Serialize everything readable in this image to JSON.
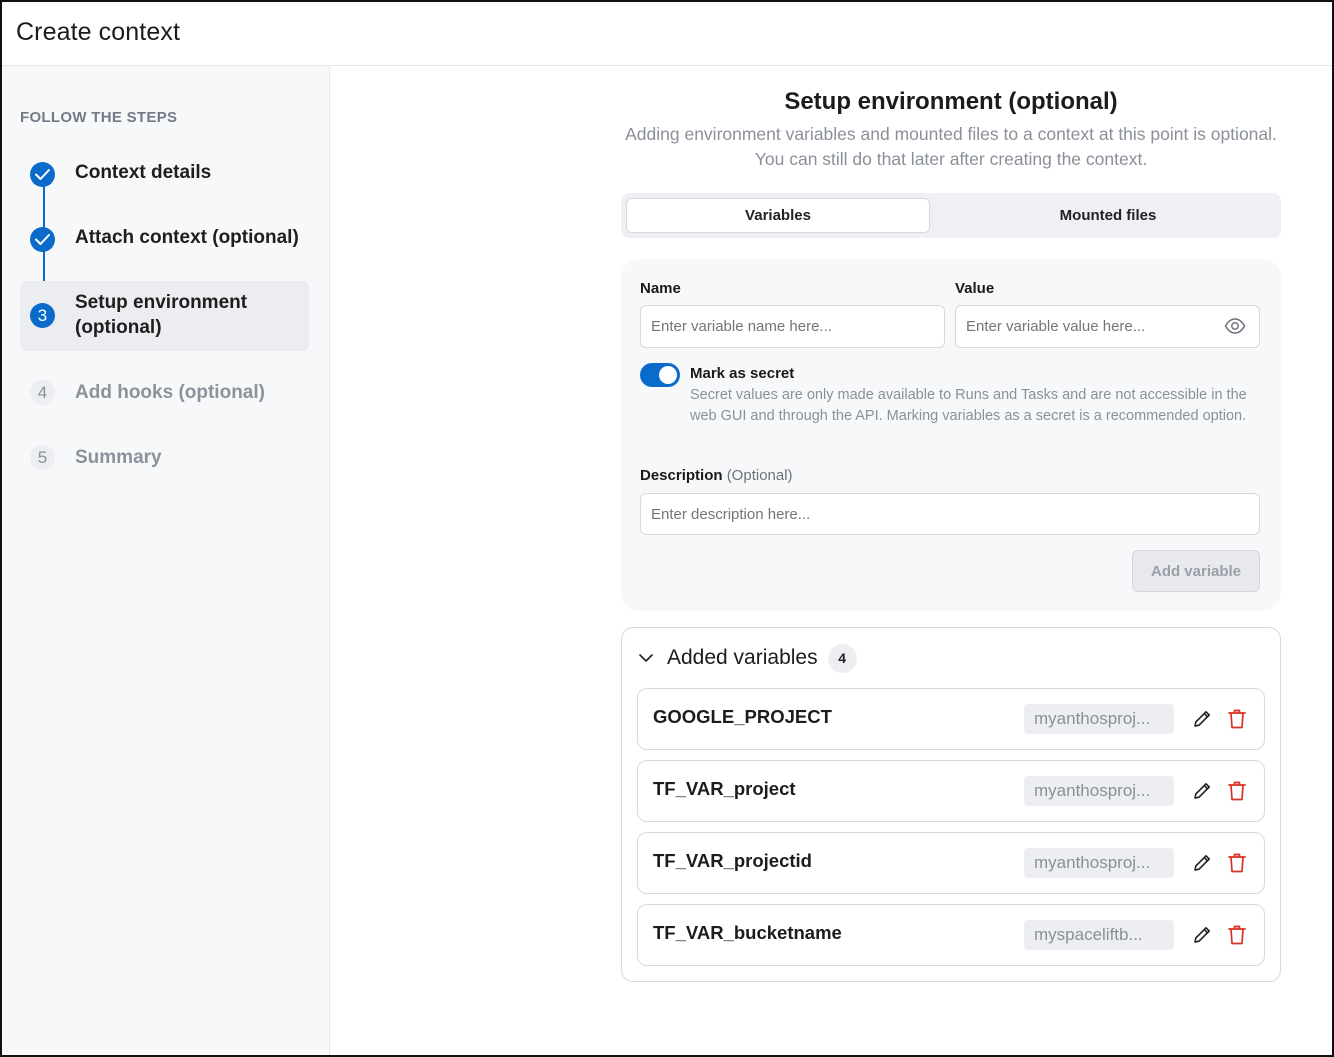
{
  "header": {
    "title": "Create context"
  },
  "sidebar": {
    "heading": "FOLLOW THE STEPS",
    "steps": [
      {
        "number": "1",
        "label": "Context details",
        "state": "done"
      },
      {
        "number": "2",
        "label": "Attach context (optional)",
        "state": "done"
      },
      {
        "number": "3",
        "label": "Setup environment (optional)",
        "state": "current"
      },
      {
        "number": "4",
        "label": "Add hooks (optional)",
        "state": "pending"
      },
      {
        "number": "5",
        "label": "Summary",
        "state": "pending"
      }
    ]
  },
  "main": {
    "title": "Setup environment (optional)",
    "subtitle": "Adding environment variables and mounted files to a context at this point is optional. You can still do that later after creating the context.",
    "tabs": [
      {
        "label": "Variables",
        "active": true
      },
      {
        "label": "Mounted files",
        "active": false
      }
    ],
    "form": {
      "name_label": "Name",
      "name_placeholder": "Enter variable name here...",
      "value_label": "Value",
      "value_placeholder": "Enter variable value here...",
      "secret_label": "Mark as secret",
      "secret_on": true,
      "secret_description": "Secret values are only made available to Runs and Tasks and are not accessible in the web GUI and through the API. Marking variables as a secret is a recommended option.",
      "description_label": "Description",
      "description_optional": "(Optional)",
      "description_placeholder": "Enter description here...",
      "add_button": "Add variable"
    },
    "added": {
      "title": "Added variables",
      "count": "4",
      "variables": [
        {
          "name": "GOOGLE_PROJECT",
          "value": "myanthosproj..."
        },
        {
          "name": "TF_VAR_project",
          "value": "myanthosproj..."
        },
        {
          "name": "TF_VAR_projectid",
          "value": "myanthosproj..."
        },
        {
          "name": "TF_VAR_bucketname",
          "value": "myspaceliftb..."
        }
      ]
    }
  },
  "colors": {
    "accent": "#0b6bcb",
    "delete": "#d93025",
    "muted": "#8a909a"
  },
  "icons": {
    "done": "check-icon",
    "reveal": "eye-icon",
    "collapse": "chevron-down-icon",
    "edit": "pencil-icon",
    "delete": "trash-icon"
  }
}
